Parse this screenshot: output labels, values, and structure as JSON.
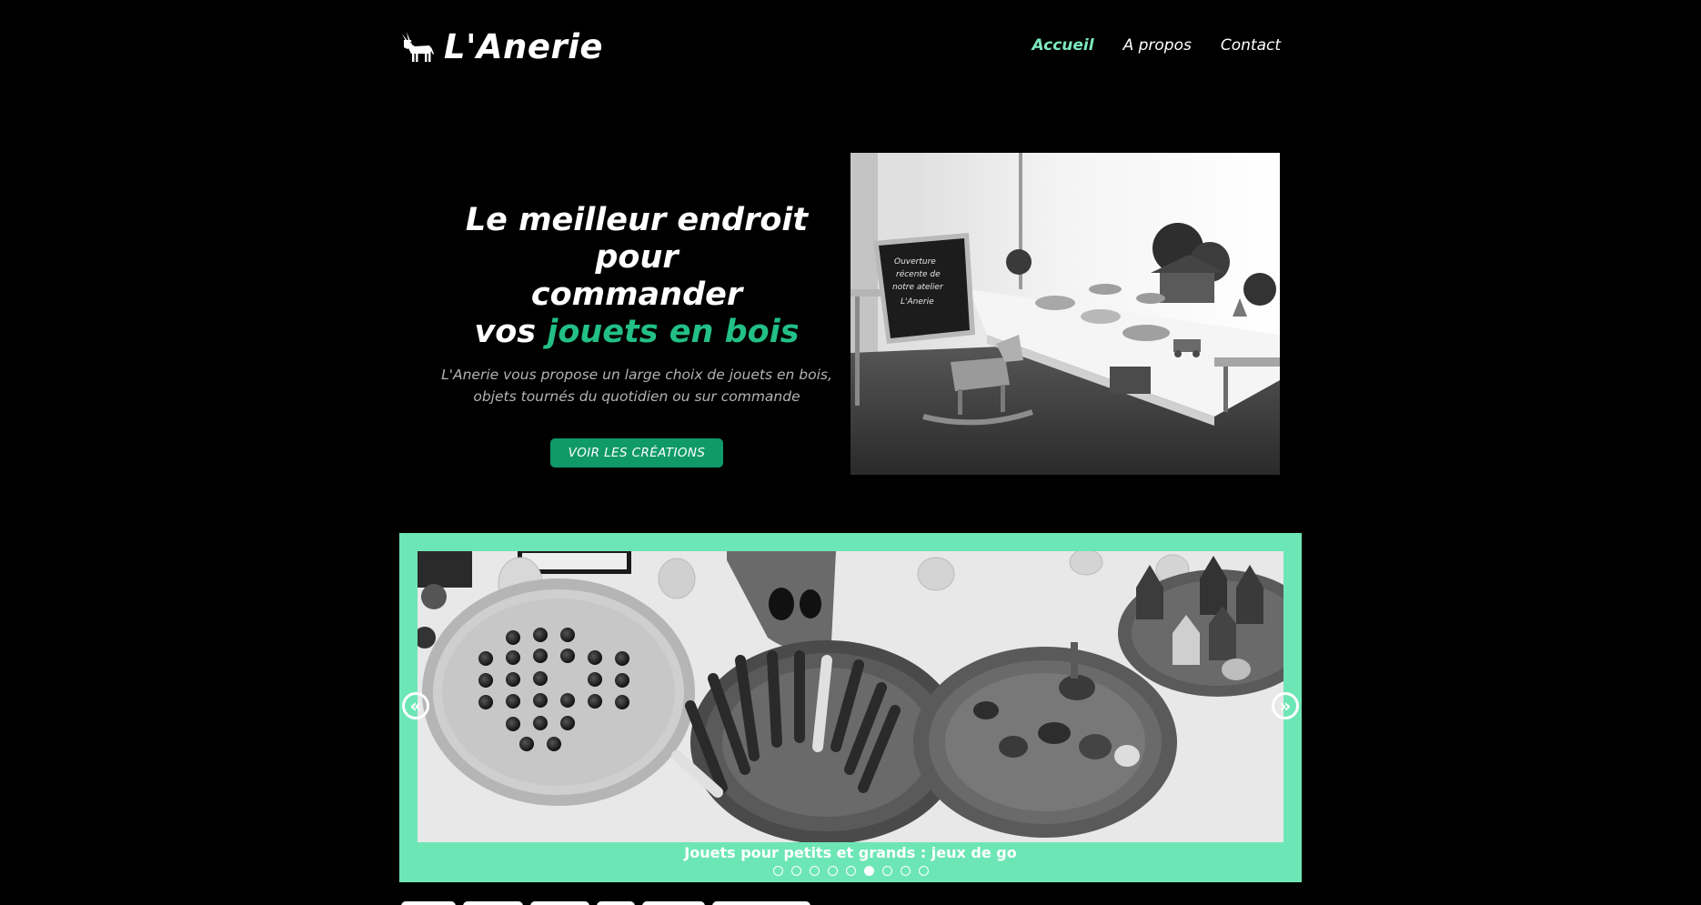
{
  "brand": {
    "name": "L'Anerie",
    "logo_icon": "donkey-icon"
  },
  "nav": {
    "items": [
      {
        "label": "Accueil",
        "active": true
      },
      {
        "label": "A propos",
        "active": false
      },
      {
        "label": "Contact",
        "active": false
      }
    ]
  },
  "hero": {
    "title_line1": "Le meilleur endroit pour",
    "title_line2": "commander",
    "title_line3_prefix": "vos ",
    "title_line3_accent": "jouets en bois",
    "subtitle": "L'Anerie vous propose un large choix de jouets en bois, objets tournés du quotidien ou sur commande",
    "cta_label": "VOIR LES CRÉATIONS",
    "photo_chalkboard_text": [
      "Ouverture",
      "récente de",
      "notre atelier",
      "L'Anerie"
    ]
  },
  "carousel": {
    "prev_icon": "chevron-double-left-icon",
    "next_icon": "chevron-double-right-icon",
    "caption": "Jouets pour petits et grands : jeux de go",
    "slide_count": 9,
    "active_index": 5
  },
  "colors": {
    "background": "#000000",
    "accent": "#22bf86",
    "nav_active": "#7de8bd",
    "cta": "#109a69",
    "carousel_frame": "#6de6b6"
  }
}
